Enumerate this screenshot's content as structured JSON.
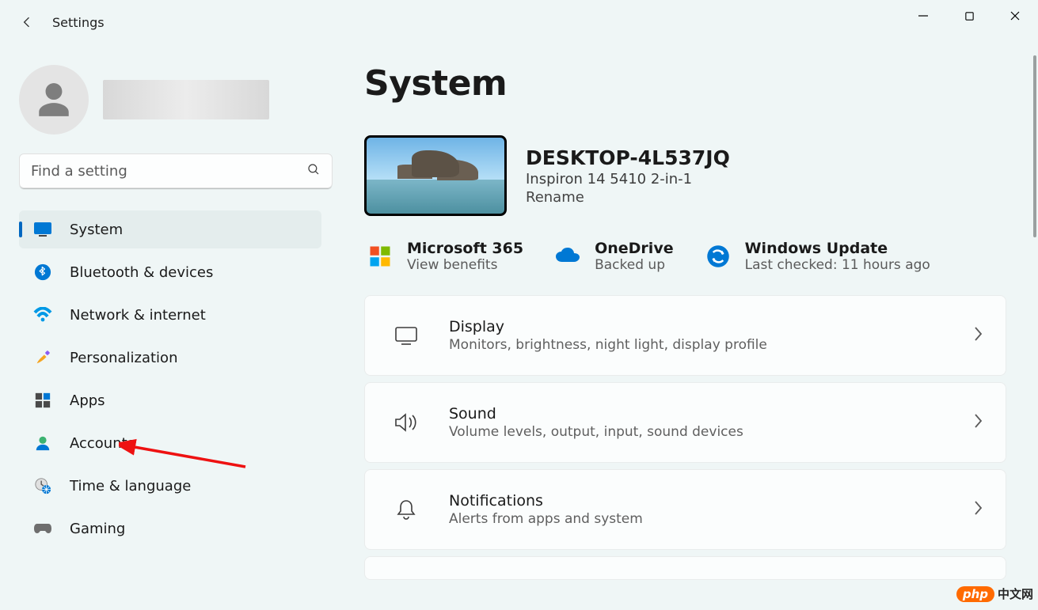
{
  "window": {
    "title": "Settings"
  },
  "search": {
    "placeholder": "Find a setting"
  },
  "sidebar": {
    "items": [
      {
        "key": "system",
        "label": "System",
        "active": true
      },
      {
        "key": "bluetooth",
        "label": "Bluetooth & devices"
      },
      {
        "key": "network",
        "label": "Network & internet"
      },
      {
        "key": "personalization",
        "label": "Personalization"
      },
      {
        "key": "apps",
        "label": "Apps"
      },
      {
        "key": "accounts",
        "label": "Accounts"
      },
      {
        "key": "time",
        "label": "Time & language"
      },
      {
        "key": "gaming",
        "label": "Gaming"
      }
    ]
  },
  "page": {
    "title": "System"
  },
  "device": {
    "name": "DESKTOP-4L537JQ",
    "model": "Inspiron 14 5410 2-in-1",
    "rename_label": "Rename"
  },
  "status": {
    "m365": {
      "title": "Microsoft 365",
      "sub": "View benefits"
    },
    "onedrive": {
      "title": "OneDrive",
      "sub": "Backed up"
    },
    "update": {
      "title": "Windows Update",
      "sub": "Last checked: 11 hours ago"
    }
  },
  "cards": [
    {
      "key": "display",
      "title": "Display",
      "sub": "Monitors, brightness, night light, display profile"
    },
    {
      "key": "sound",
      "title": "Sound",
      "sub": "Volume levels, output, input, sound devices"
    },
    {
      "key": "notifications",
      "title": "Notifications",
      "sub": "Alerts from apps and system"
    }
  ],
  "watermark": {
    "brand": "php",
    "text": "中文网"
  }
}
